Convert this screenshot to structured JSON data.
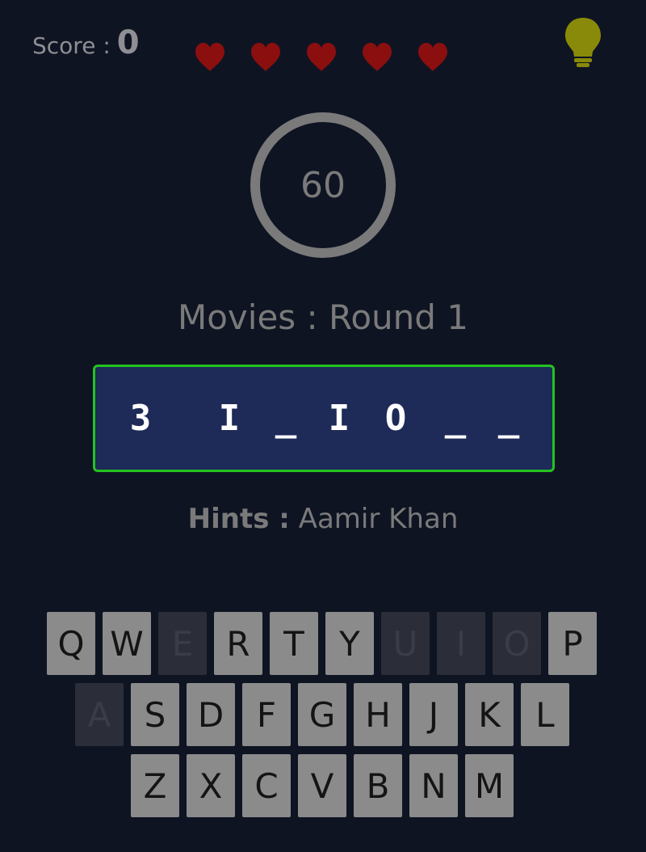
{
  "score": {
    "label": "Score :",
    "value": "0"
  },
  "lives": {
    "count": 5,
    "color": "#8b0f0f"
  },
  "hint_button": {
    "icon": "lightbulb-icon",
    "color": "#8a8a0a"
  },
  "timer": {
    "value": "60",
    "ring_color": "#7a7a7a"
  },
  "round": {
    "text": "Movies : Round 1"
  },
  "word": {
    "letters": [
      "3",
      "",
      "I",
      "_",
      "I",
      "O",
      "_",
      "_"
    ],
    "box_color": "#1e2a57",
    "border_color": "#23c31f"
  },
  "hints": {
    "label": "Hints :",
    "text": "Aamir Khan"
  },
  "keyboard": {
    "rows": [
      [
        {
          "key": "Q",
          "used": false
        },
        {
          "key": "W",
          "used": false
        },
        {
          "key": "E",
          "used": true
        },
        {
          "key": "R",
          "used": false
        },
        {
          "key": "T",
          "used": false
        },
        {
          "key": "Y",
          "used": false
        },
        {
          "key": "U",
          "used": true
        },
        {
          "key": "I",
          "used": true
        },
        {
          "key": "O",
          "used": true
        },
        {
          "key": "P",
          "used": false
        }
      ],
      [
        {
          "key": "A",
          "used": true
        },
        {
          "key": "S",
          "used": false
        },
        {
          "key": "D",
          "used": false
        },
        {
          "key": "F",
          "used": false
        },
        {
          "key": "G",
          "used": false
        },
        {
          "key": "H",
          "used": false
        },
        {
          "key": "J",
          "used": false
        },
        {
          "key": "K",
          "used": false
        },
        {
          "key": "L",
          "used": false
        }
      ],
      [
        {
          "key": "Z",
          "used": false
        },
        {
          "key": "X",
          "used": false
        },
        {
          "key": "C",
          "used": false
        },
        {
          "key": "V",
          "used": false
        },
        {
          "key": "B",
          "used": false
        },
        {
          "key": "N",
          "used": false
        },
        {
          "key": "M",
          "used": false
        }
      ]
    ],
    "active_color": "#8b8b8b",
    "used_color": "#2b2e38"
  }
}
